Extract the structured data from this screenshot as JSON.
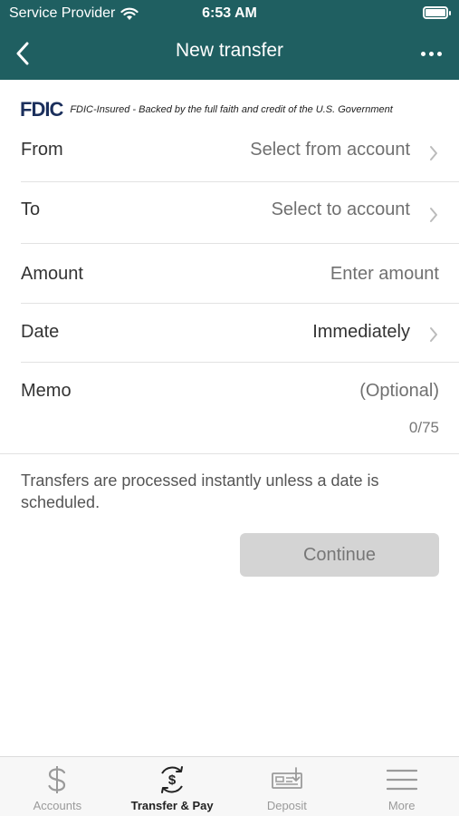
{
  "status_bar": {
    "carrier": "Service Provider",
    "time": "6:53 AM"
  },
  "nav": {
    "title": "New transfer"
  },
  "fdic": {
    "logo": "FDIC",
    "text": "FDIC-Insured - Backed by the full faith and credit of the U.S. Government"
  },
  "form": {
    "from": {
      "label": "From",
      "value": "Select from account"
    },
    "to": {
      "label": "To",
      "value": "Select to account"
    },
    "amount": {
      "label": "Amount",
      "placeholder": "Enter amount"
    },
    "date": {
      "label": "Date",
      "value": "Immediately"
    },
    "memo": {
      "label": "Memo",
      "placeholder": "(Optional)",
      "counter": "0/75"
    }
  },
  "info_text": "Transfers are processed instantly unless a date is scheduled.",
  "continue_label": "Continue",
  "tab_bar": {
    "items": [
      {
        "label": "Accounts",
        "icon": "dollar-icon",
        "active": false
      },
      {
        "label": "Transfer & Pay",
        "icon": "transfer-pay-icon",
        "active": true
      },
      {
        "label": "Deposit",
        "icon": "deposit-check-icon",
        "active": false
      },
      {
        "label": "More",
        "icon": "menu-icon",
        "active": false
      }
    ]
  }
}
